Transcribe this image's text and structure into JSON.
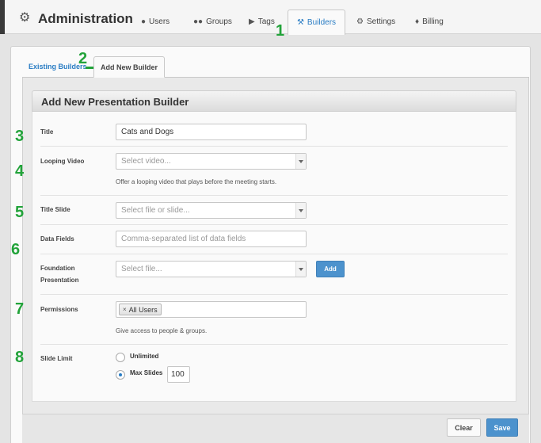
{
  "header": {
    "title": "Administration",
    "title_icon": "gear-icon",
    "nav": [
      {
        "label": "Users",
        "icon": "user-icon"
      },
      {
        "label": "Groups",
        "icon": "group-icon"
      },
      {
        "label": "Tags",
        "icon": "tag-icon"
      },
      {
        "label": "Builders",
        "icon": "wrench-icon",
        "active": true
      },
      {
        "label": "Settings",
        "icon": "gears-icon"
      },
      {
        "label": "Billing",
        "icon": "money-icon"
      }
    ]
  },
  "tabs": {
    "existing": "Existing Builders",
    "add_new": "Add New Builder"
  },
  "panel": {
    "title": "Add New Presentation Builder"
  },
  "form": {
    "title": {
      "label": "Title",
      "value": "Cats and Dogs"
    },
    "looping_video": {
      "label": "Looping Video",
      "placeholder": "Select video...",
      "help": "Offer a looping video that plays before the meeting starts."
    },
    "title_slide": {
      "label": "Title Slide",
      "placeholder": "Select file or slide..."
    },
    "data_fields": {
      "label": "Data Fields",
      "placeholder": "Comma-separated list of data fields"
    },
    "foundation_presentation": {
      "label_line1": "Foundation",
      "label_line2": "Presentation",
      "placeholder": "Select file...",
      "add_label": "Add"
    },
    "permissions": {
      "label": "Permissions",
      "tag_remove": "×",
      "tag": "All Users",
      "help": "Give access to people & groups."
    },
    "slide_limit": {
      "label": "Slide Limit",
      "unlimited_label": "Unlimited",
      "max_label": "Max Slides",
      "max_value": "100",
      "selected": "max"
    }
  },
  "footer": {
    "clear_label": "Clear",
    "save_label": "Save"
  },
  "markers": [
    "1",
    "2",
    "3",
    "4",
    "5",
    "6",
    "7",
    "8"
  ],
  "colors": {
    "accent": "#2a7dc4",
    "primary_button": "#4c92cd",
    "annotation": "#22a33a"
  }
}
